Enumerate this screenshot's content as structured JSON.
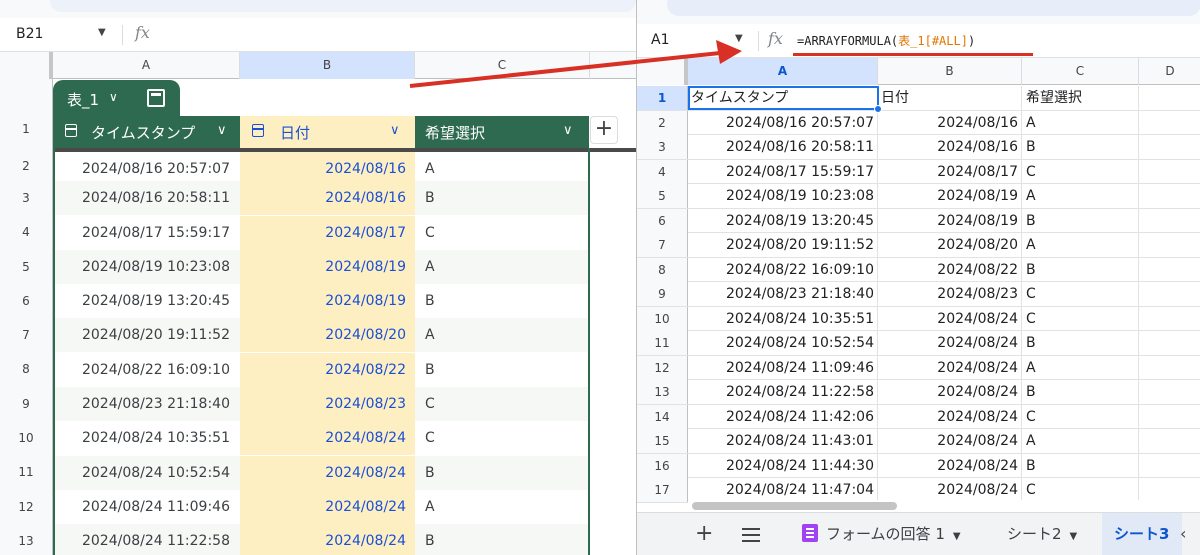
{
  "left": {
    "namebox": "B21",
    "fx": "fx",
    "columns": [
      "A",
      "B",
      "C"
    ],
    "table_name": "表_1",
    "headers": [
      "タイムスタンプ",
      "日付",
      "希望選択"
    ],
    "header_row_label": "1",
    "add_button": "+",
    "rows": [
      {
        "n": "2",
        "a": "2024/08/16 20:57:07",
        "b": "2024/08/16",
        "c": "A"
      },
      {
        "n": "3",
        "a": "2024/08/16 20:58:11",
        "b": "2024/08/16",
        "c": "B"
      },
      {
        "n": "4",
        "a": "2024/08/17 15:59:17",
        "b": "2024/08/17",
        "c": "C"
      },
      {
        "n": "5",
        "a": "2024/08/19 10:23:08",
        "b": "2024/08/19",
        "c": "A"
      },
      {
        "n": "6",
        "a": "2024/08/19 13:20:45",
        "b": "2024/08/19",
        "c": "B"
      },
      {
        "n": "7",
        "a": "2024/08/20 19:11:52",
        "b": "2024/08/20",
        "c": "A"
      },
      {
        "n": "8",
        "a": "2024/08/22 16:09:10",
        "b": "2024/08/22",
        "c": "B"
      },
      {
        "n": "9",
        "a": "2024/08/23 21:18:40",
        "b": "2024/08/23",
        "c": "C"
      },
      {
        "n": "10",
        "a": "2024/08/24 10:35:51",
        "b": "2024/08/24",
        "c": "C"
      },
      {
        "n": "11",
        "a": "2024/08/24 10:52:54",
        "b": "2024/08/24",
        "c": "B"
      },
      {
        "n": "12",
        "a": "2024/08/24 11:09:46",
        "b": "2024/08/24",
        "c": "A"
      },
      {
        "n": "13",
        "a": "2024/08/24 11:22:58",
        "b": "2024/08/24",
        "c": "B"
      }
    ],
    "colors": {
      "table_green": "#2d6a4f",
      "date_col_bg": "#feefc3",
      "date_text": "#1a4fd6"
    },
    "icons": {
      "dropdown": "chevron-down-icon",
      "date_header": "calendar-icon",
      "table_menu": "table-calculator-icon"
    }
  },
  "right": {
    "namebox": "A1",
    "fx": "fx",
    "formula_prefix": "=ARRAYFORMULA(",
    "formula_ref": "表_1[#ALL]",
    "formula_suffix": ")",
    "columns": [
      "A",
      "B",
      "C",
      "D"
    ],
    "header": {
      "n": "1",
      "a": "タイムスタンプ",
      "b": "日付",
      "c": "希望選択"
    },
    "rows": [
      {
        "n": "2",
        "a": "2024/08/16 20:57:07",
        "b": "2024/08/16",
        "c": "A"
      },
      {
        "n": "3",
        "a": "2024/08/16 20:58:11",
        "b": "2024/08/16",
        "c": "B"
      },
      {
        "n": "4",
        "a": "2024/08/17 15:59:17",
        "b": "2024/08/17",
        "c": "C"
      },
      {
        "n": "5",
        "a": "2024/08/19 10:23:08",
        "b": "2024/08/19",
        "c": "A"
      },
      {
        "n": "6",
        "a": "2024/08/19 13:20:45",
        "b": "2024/08/19",
        "c": "B"
      },
      {
        "n": "7",
        "a": "2024/08/20 19:11:52",
        "b": "2024/08/20",
        "c": "A"
      },
      {
        "n": "8",
        "a": "2024/08/22 16:09:10",
        "b": "2024/08/22",
        "c": "B"
      },
      {
        "n": "9",
        "a": "2024/08/23 21:18:40",
        "b": "2024/08/23",
        "c": "C"
      },
      {
        "n": "10",
        "a": "2024/08/24 10:35:51",
        "b": "2024/08/24",
        "c": "C"
      },
      {
        "n": "11",
        "a": "2024/08/24 10:52:54",
        "b": "2024/08/24",
        "c": "B"
      },
      {
        "n": "12",
        "a": "2024/08/24 11:09:46",
        "b": "2024/08/24",
        "c": "A"
      },
      {
        "n": "13",
        "a": "2024/08/24 11:22:58",
        "b": "2024/08/24",
        "c": "B"
      },
      {
        "n": "14",
        "a": "2024/08/24 11:42:06",
        "b": "2024/08/24",
        "c": "C"
      },
      {
        "n": "15",
        "a": "2024/08/24 11:43:01",
        "b": "2024/08/24",
        "c": "A"
      },
      {
        "n": "16",
        "a": "2024/08/24 11:44:30",
        "b": "2024/08/24",
        "c": "B"
      },
      {
        "n": "17",
        "a": "2024/08/24 11:47:04",
        "b": "2024/08/24",
        "c": "C"
      }
    ],
    "sheet_tabs": {
      "add": "+",
      "form_responses": "フォームの回答 1",
      "sheet2": "シート2",
      "sheet3_partial": "シート3",
      "more": "‹"
    },
    "colors": {
      "selection": "#1a73e8",
      "formula_ref": "#e37400",
      "underline": "#d93025",
      "active_tab": "#0b57d0"
    },
    "icons": {
      "sheet_menu": "list-menu-icon",
      "form": "form-icon"
    }
  },
  "annotation": {
    "arrow_color": "#d93025"
  }
}
